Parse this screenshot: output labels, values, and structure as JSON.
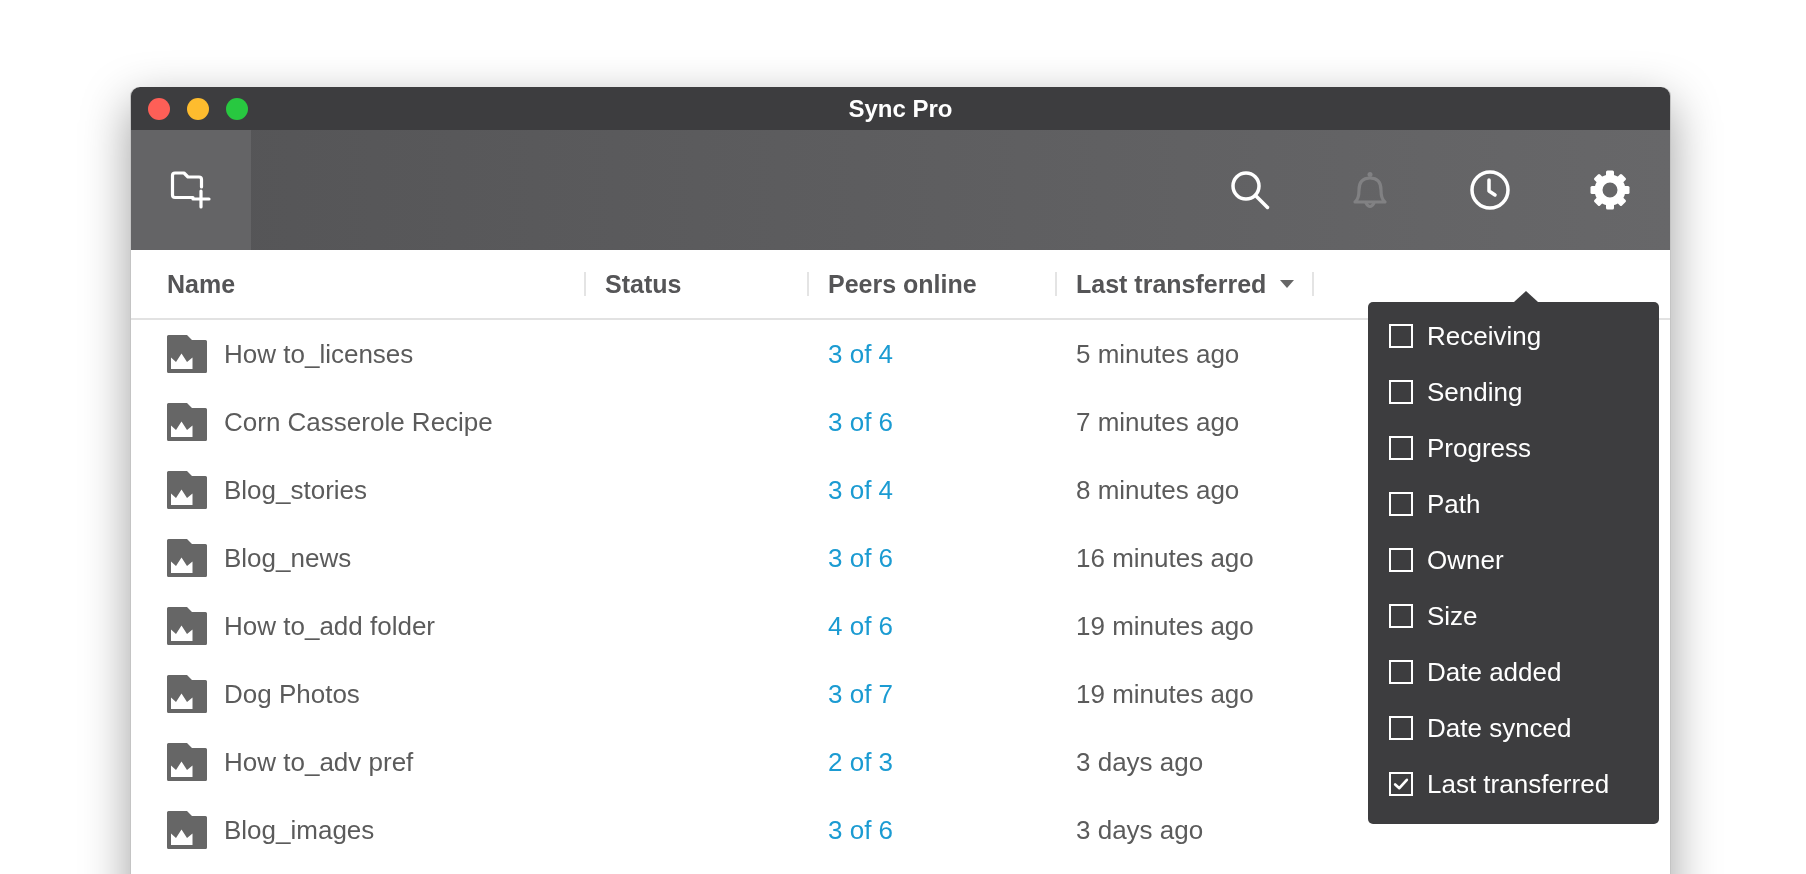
{
  "window": {
    "title": "Sync Pro"
  },
  "toolbar": {
    "left": [
      {
        "kind": "add_folder",
        "disabled": false
      }
    ],
    "right": [
      {
        "kind": "search",
        "disabled": false
      },
      {
        "kind": "notifications",
        "disabled": true
      },
      {
        "kind": "history",
        "disabled": false
      },
      {
        "kind": "settings",
        "disabled": false
      }
    ]
  },
  "table": {
    "columns": [
      {
        "label": "Name",
        "sorted": false
      },
      {
        "label": "Status",
        "sorted": false
      },
      {
        "label": "Peers online",
        "sorted": false
      },
      {
        "label": "Last transferred",
        "sorted": true
      }
    ],
    "rows": [
      {
        "name": "How to_licenses",
        "peers": "3 of 4",
        "last_transferred": "5 minutes ago"
      },
      {
        "name": "Corn Casserole Recipe",
        "peers": "3 of 6",
        "last_transferred": "7 minutes ago"
      },
      {
        "name": "Blog_stories",
        "peers": "3 of 4",
        "last_transferred": "8 minutes ago"
      },
      {
        "name": "Blog_news",
        "peers": "3 of 6",
        "last_transferred": "16 minutes ago"
      },
      {
        "name": "How to_add folder",
        "peers": "4 of 6",
        "last_transferred": "19 minutes ago"
      },
      {
        "name": "Dog Photos",
        "peers": "3 of 7",
        "last_transferred": "19 minutes ago"
      },
      {
        "name": "How to_adv pref",
        "peers": "2 of 3",
        "last_transferred": "3 days ago"
      },
      {
        "name": "Blog_images",
        "peers": "3 of 6",
        "last_transferred": "3 days ago"
      }
    ]
  },
  "column_menu": {
    "items": [
      {
        "label": "Receiving",
        "checked": false
      },
      {
        "label": "Sending",
        "checked": false
      },
      {
        "label": "Progress",
        "checked": false
      },
      {
        "label": "Path",
        "checked": false
      },
      {
        "label": "Owner",
        "checked": false
      },
      {
        "label": "Size",
        "checked": false
      },
      {
        "label": "Date added",
        "checked": false
      },
      {
        "label": "Date synced",
        "checked": false
      },
      {
        "label": "Last transferred",
        "checked": true
      }
    ]
  }
}
